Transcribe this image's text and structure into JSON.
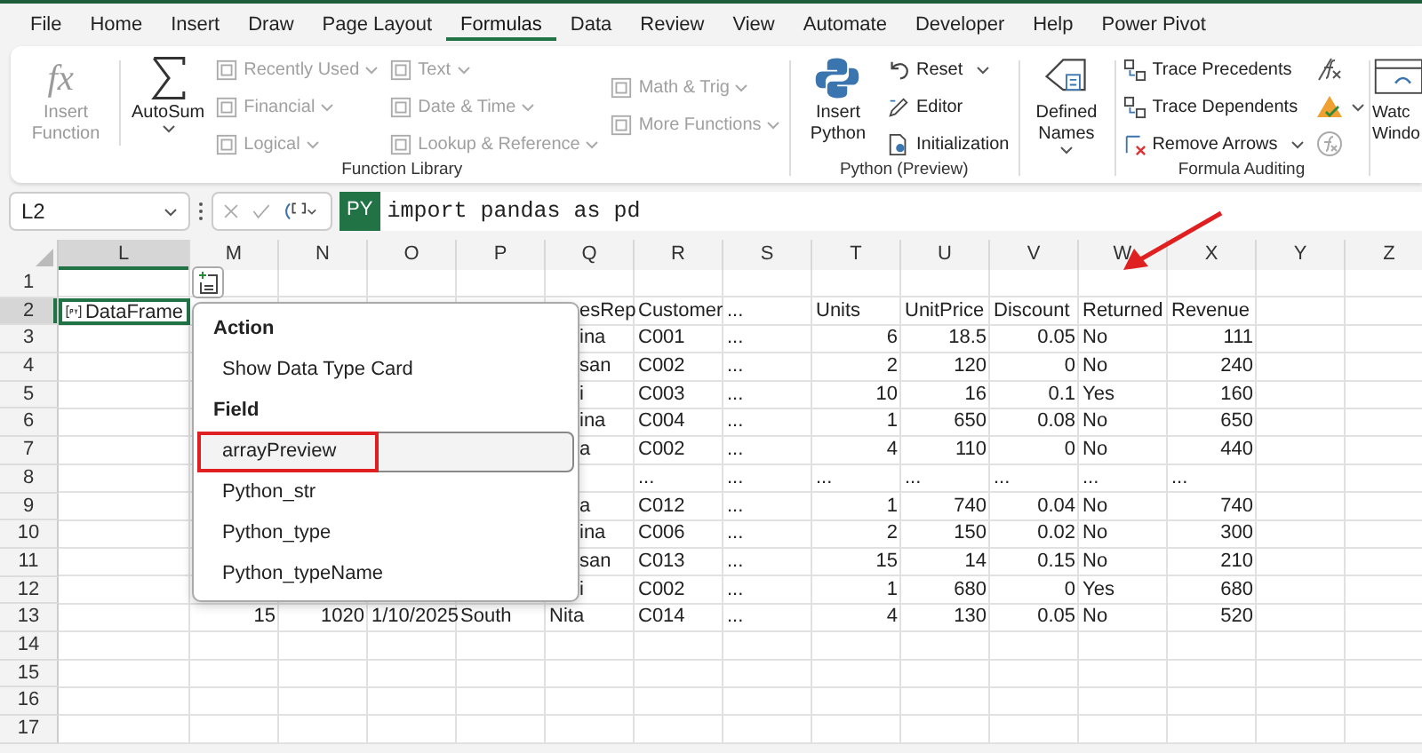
{
  "ribbon": {
    "tabs": [
      {
        "label": "File",
        "selected": false
      },
      {
        "label": "Home",
        "selected": false
      },
      {
        "label": "Insert",
        "selected": false
      },
      {
        "label": "Draw",
        "selected": false
      },
      {
        "label": "Page Layout",
        "selected": false
      },
      {
        "label": "Formulas",
        "selected": true
      },
      {
        "label": "Data",
        "selected": false
      },
      {
        "label": "Review",
        "selected": false
      },
      {
        "label": "View",
        "selected": false
      },
      {
        "label": "Automate",
        "selected": false
      },
      {
        "label": "Developer",
        "selected": false
      },
      {
        "label": "Help",
        "selected": false
      },
      {
        "label": "Power Pivot",
        "selected": false
      }
    ],
    "function_library": {
      "label": "Function Library",
      "insert_function": {
        "symbol": "fx",
        "label": "Insert Function",
        "disabled": true
      },
      "autosum": {
        "label": "AutoSum",
        "disabled": false
      },
      "categories": [
        [
          {
            "label": "Recently Used",
            "disabled": true
          },
          {
            "label": "Financial",
            "disabled": true
          },
          {
            "label": "Logical",
            "disabled": true
          }
        ],
        [
          {
            "label": "Text",
            "disabled": true
          },
          {
            "label": "Date & Time",
            "disabled": true
          },
          {
            "label": "Lookup & Reference",
            "disabled": true
          }
        ],
        [
          {
            "label": "Math & Trig",
            "disabled": true
          },
          {
            "label": "More Functions",
            "disabled": true
          }
        ]
      ]
    },
    "python": {
      "label": "Python (Preview)",
      "insert_python": {
        "label": "Insert Python"
      },
      "commands": [
        {
          "label": "Reset"
        },
        {
          "label": "Editor"
        },
        {
          "label": "Initialization"
        }
      ]
    },
    "defined_names": {
      "label": "Defined Names"
    },
    "formula_auditing": {
      "label": "Formula Auditing",
      "commands": [
        {
          "label": "Trace Precedents"
        },
        {
          "label": "Trace Dependents"
        },
        {
          "label": "Remove Arrows"
        }
      ]
    },
    "watch_window": {
      "label_lines": [
        "Watc",
        "Windo"
      ]
    }
  },
  "formula_bar": {
    "name_box": "L2",
    "badge": "PY",
    "formula": "import pandas as pd"
  },
  "sheet": {
    "columns": [
      {
        "label": "L",
        "selected": true
      },
      {
        "label": "M",
        "selected": false
      },
      {
        "label": "N",
        "selected": false
      },
      {
        "label": "O",
        "selected": false
      },
      {
        "label": "P",
        "selected": false
      },
      {
        "label": "Q",
        "selected": false
      },
      {
        "label": "R",
        "selected": false
      },
      {
        "label": "S",
        "selected": false
      },
      {
        "label": "T",
        "selected": false
      },
      {
        "label": "U",
        "selected": false
      },
      {
        "label": "V",
        "selected": false
      },
      {
        "label": "W",
        "selected": false
      },
      {
        "label": "X",
        "selected": false
      },
      {
        "label": "Y",
        "selected": false
      },
      {
        "label": "Z",
        "selected": false
      }
    ],
    "rows": [
      {
        "number": "1",
        "selected": false
      },
      {
        "number": "2",
        "selected": true,
        "cells": [
          {
            "kind": "python",
            "text": "DataFrame"
          },
          {
            "kind": "empty"
          },
          {
            "kind": "empty"
          },
          {
            "kind": "empty"
          },
          {
            "kind": "empty"
          },
          {
            "kind": "clipped",
            "text": "esRep"
          },
          {
            "kind": "text",
            "text": "Customer"
          },
          {
            "kind": "text",
            "text": "..."
          },
          {
            "kind": "text",
            "text": "Units"
          },
          {
            "kind": "text",
            "text": "UnitPrice"
          },
          {
            "kind": "text",
            "text": "Discount"
          },
          {
            "kind": "text",
            "text": "Returned"
          },
          {
            "kind": "text",
            "text": "Revenue"
          }
        ]
      },
      {
        "number": "3",
        "selected": false,
        "cells": [
          {
            "kind": "empty"
          },
          {
            "kind": "empty"
          },
          {
            "kind": "empty"
          },
          {
            "kind": "empty"
          },
          {
            "kind": "empty"
          },
          {
            "kind": "clipped",
            "text": "ina"
          },
          {
            "kind": "text",
            "text": "C001"
          },
          {
            "kind": "text",
            "text": "..."
          },
          {
            "kind": "number",
            "text": "6"
          },
          {
            "kind": "number",
            "text": "18.5"
          },
          {
            "kind": "number",
            "text": "0.05"
          },
          {
            "kind": "text",
            "text": "No"
          },
          {
            "kind": "number",
            "text": "111"
          }
        ]
      },
      {
        "number": "4",
        "selected": false,
        "cells": [
          {
            "kind": "empty"
          },
          {
            "kind": "empty"
          },
          {
            "kind": "empty"
          },
          {
            "kind": "empty"
          },
          {
            "kind": "empty"
          },
          {
            "kind": "clipped",
            "text": "san"
          },
          {
            "kind": "text",
            "text": "C002"
          },
          {
            "kind": "text",
            "text": "..."
          },
          {
            "kind": "number",
            "text": "2"
          },
          {
            "kind": "number",
            "text": "120"
          },
          {
            "kind": "number",
            "text": "0"
          },
          {
            "kind": "text",
            "text": "No"
          },
          {
            "kind": "number",
            "text": "240"
          }
        ]
      },
      {
        "number": "5",
        "selected": false,
        "cells": [
          {
            "kind": "empty"
          },
          {
            "kind": "empty"
          },
          {
            "kind": "empty"
          },
          {
            "kind": "empty"
          },
          {
            "kind": "empty"
          },
          {
            "kind": "clipped",
            "text": "i"
          },
          {
            "kind": "text",
            "text": "C003"
          },
          {
            "kind": "text",
            "text": "..."
          },
          {
            "kind": "number",
            "text": "10"
          },
          {
            "kind": "number",
            "text": "16"
          },
          {
            "kind": "number",
            "text": "0.1"
          },
          {
            "kind": "text",
            "text": "Yes"
          },
          {
            "kind": "number",
            "text": "160"
          }
        ]
      },
      {
        "number": "6",
        "selected": false,
        "cells": [
          {
            "kind": "empty"
          },
          {
            "kind": "empty"
          },
          {
            "kind": "empty"
          },
          {
            "kind": "empty"
          },
          {
            "kind": "empty"
          },
          {
            "kind": "clipped",
            "text": "ina"
          },
          {
            "kind": "text",
            "text": "C004"
          },
          {
            "kind": "text",
            "text": "..."
          },
          {
            "kind": "number",
            "text": "1"
          },
          {
            "kind": "number",
            "text": "650"
          },
          {
            "kind": "number",
            "text": "0.08"
          },
          {
            "kind": "text",
            "text": "No"
          },
          {
            "kind": "number",
            "text": "650"
          }
        ]
      },
      {
        "number": "7",
        "selected": false,
        "cells": [
          {
            "kind": "empty"
          },
          {
            "kind": "empty"
          },
          {
            "kind": "empty"
          },
          {
            "kind": "empty"
          },
          {
            "kind": "empty"
          },
          {
            "kind": "clipped",
            "text": "a"
          },
          {
            "kind": "text",
            "text": "C002"
          },
          {
            "kind": "text",
            "text": "..."
          },
          {
            "kind": "number",
            "text": "4"
          },
          {
            "kind": "number",
            "text": "110"
          },
          {
            "kind": "number",
            "text": "0"
          },
          {
            "kind": "text",
            "text": "No"
          },
          {
            "kind": "number",
            "text": "440"
          }
        ]
      },
      {
        "number": "8",
        "selected": false,
        "cells": [
          {
            "kind": "empty"
          },
          {
            "kind": "empty"
          },
          {
            "kind": "empty"
          },
          {
            "kind": "empty"
          },
          {
            "kind": "empty"
          },
          {
            "kind": "empty"
          },
          {
            "kind": "text",
            "text": "..."
          },
          {
            "kind": "text",
            "text": "..."
          },
          {
            "kind": "text",
            "text": "..."
          },
          {
            "kind": "text",
            "text": "..."
          },
          {
            "kind": "text",
            "text": "..."
          },
          {
            "kind": "text",
            "text": "..."
          },
          {
            "kind": "text",
            "text": "..."
          }
        ]
      },
      {
        "number": "9",
        "selected": false,
        "cells": [
          {
            "kind": "empty"
          },
          {
            "kind": "empty"
          },
          {
            "kind": "empty"
          },
          {
            "kind": "empty"
          },
          {
            "kind": "empty"
          },
          {
            "kind": "clipped",
            "text": "a"
          },
          {
            "kind": "text",
            "text": "C012"
          },
          {
            "kind": "text",
            "text": "..."
          },
          {
            "kind": "number",
            "text": "1"
          },
          {
            "kind": "number",
            "text": "740"
          },
          {
            "kind": "number",
            "text": "0.04"
          },
          {
            "kind": "text",
            "text": "No"
          },
          {
            "kind": "number",
            "text": "740"
          }
        ]
      },
      {
        "number": "10",
        "selected": false,
        "cells": [
          {
            "kind": "empty"
          },
          {
            "kind": "empty"
          },
          {
            "kind": "empty"
          },
          {
            "kind": "empty"
          },
          {
            "kind": "empty"
          },
          {
            "kind": "clipped",
            "text": "ina"
          },
          {
            "kind": "text",
            "text": "C006"
          },
          {
            "kind": "text",
            "text": "..."
          },
          {
            "kind": "number",
            "text": "2"
          },
          {
            "kind": "number",
            "text": "150"
          },
          {
            "kind": "number",
            "text": "0.02"
          },
          {
            "kind": "text",
            "text": "No"
          },
          {
            "kind": "number",
            "text": "300"
          }
        ]
      },
      {
        "number": "11",
        "selected": false,
        "cells": [
          {
            "kind": "empty"
          },
          {
            "kind": "empty"
          },
          {
            "kind": "empty"
          },
          {
            "kind": "empty"
          },
          {
            "kind": "empty"
          },
          {
            "kind": "clipped",
            "text": "san"
          },
          {
            "kind": "text",
            "text": "C013"
          },
          {
            "kind": "text",
            "text": "..."
          },
          {
            "kind": "number",
            "text": "15"
          },
          {
            "kind": "number",
            "text": "14"
          },
          {
            "kind": "number",
            "text": "0.15"
          },
          {
            "kind": "text",
            "text": "No"
          },
          {
            "kind": "number",
            "text": "210"
          }
        ]
      },
      {
        "number": "12",
        "selected": false,
        "cells": [
          {
            "kind": "empty"
          },
          {
            "kind": "empty"
          },
          {
            "kind": "empty"
          },
          {
            "kind": "empty"
          },
          {
            "kind": "empty"
          },
          {
            "kind": "clipped",
            "text": "i"
          },
          {
            "kind": "text",
            "text": "C002"
          },
          {
            "kind": "text",
            "text": "..."
          },
          {
            "kind": "number",
            "text": "1"
          },
          {
            "kind": "number",
            "text": "680"
          },
          {
            "kind": "number",
            "text": "0"
          },
          {
            "kind": "text",
            "text": "Yes"
          },
          {
            "kind": "number",
            "text": "680"
          }
        ]
      },
      {
        "number": "13",
        "selected": false,
        "cells": [
          {
            "kind": "empty"
          },
          {
            "kind": "number",
            "text": "15"
          },
          {
            "kind": "number",
            "text": "1020"
          },
          {
            "kind": "number",
            "text": "1/10/2025"
          },
          {
            "kind": "text",
            "text": "South"
          },
          {
            "kind": "text",
            "text": "Nita"
          },
          {
            "kind": "text",
            "text": "C014"
          },
          {
            "kind": "text",
            "text": "..."
          },
          {
            "kind": "number",
            "text": "4"
          },
          {
            "kind": "number",
            "text": "130"
          },
          {
            "kind": "number",
            "text": "0.05"
          },
          {
            "kind": "text",
            "text": "No"
          },
          {
            "kind": "number",
            "text": "520"
          }
        ]
      },
      {
        "number": "14",
        "selected": false
      },
      {
        "number": "15",
        "selected": false
      },
      {
        "number": "16",
        "selected": false
      },
      {
        "number": "17",
        "selected": false
      }
    ]
  },
  "context_menu": {
    "sections": [
      {
        "heading": "Action",
        "items": [
          {
            "label": "Show Data Type Card",
            "selected": false
          }
        ]
      },
      {
        "heading": "Field",
        "items": [
          {
            "label": "arrayPreview",
            "selected": true
          },
          {
            "label": "Python_str",
            "selected": false
          },
          {
            "label": "Python_type",
            "selected": false
          },
          {
            "label": "Python_typeName",
            "selected": false
          }
        ]
      }
    ]
  }
}
